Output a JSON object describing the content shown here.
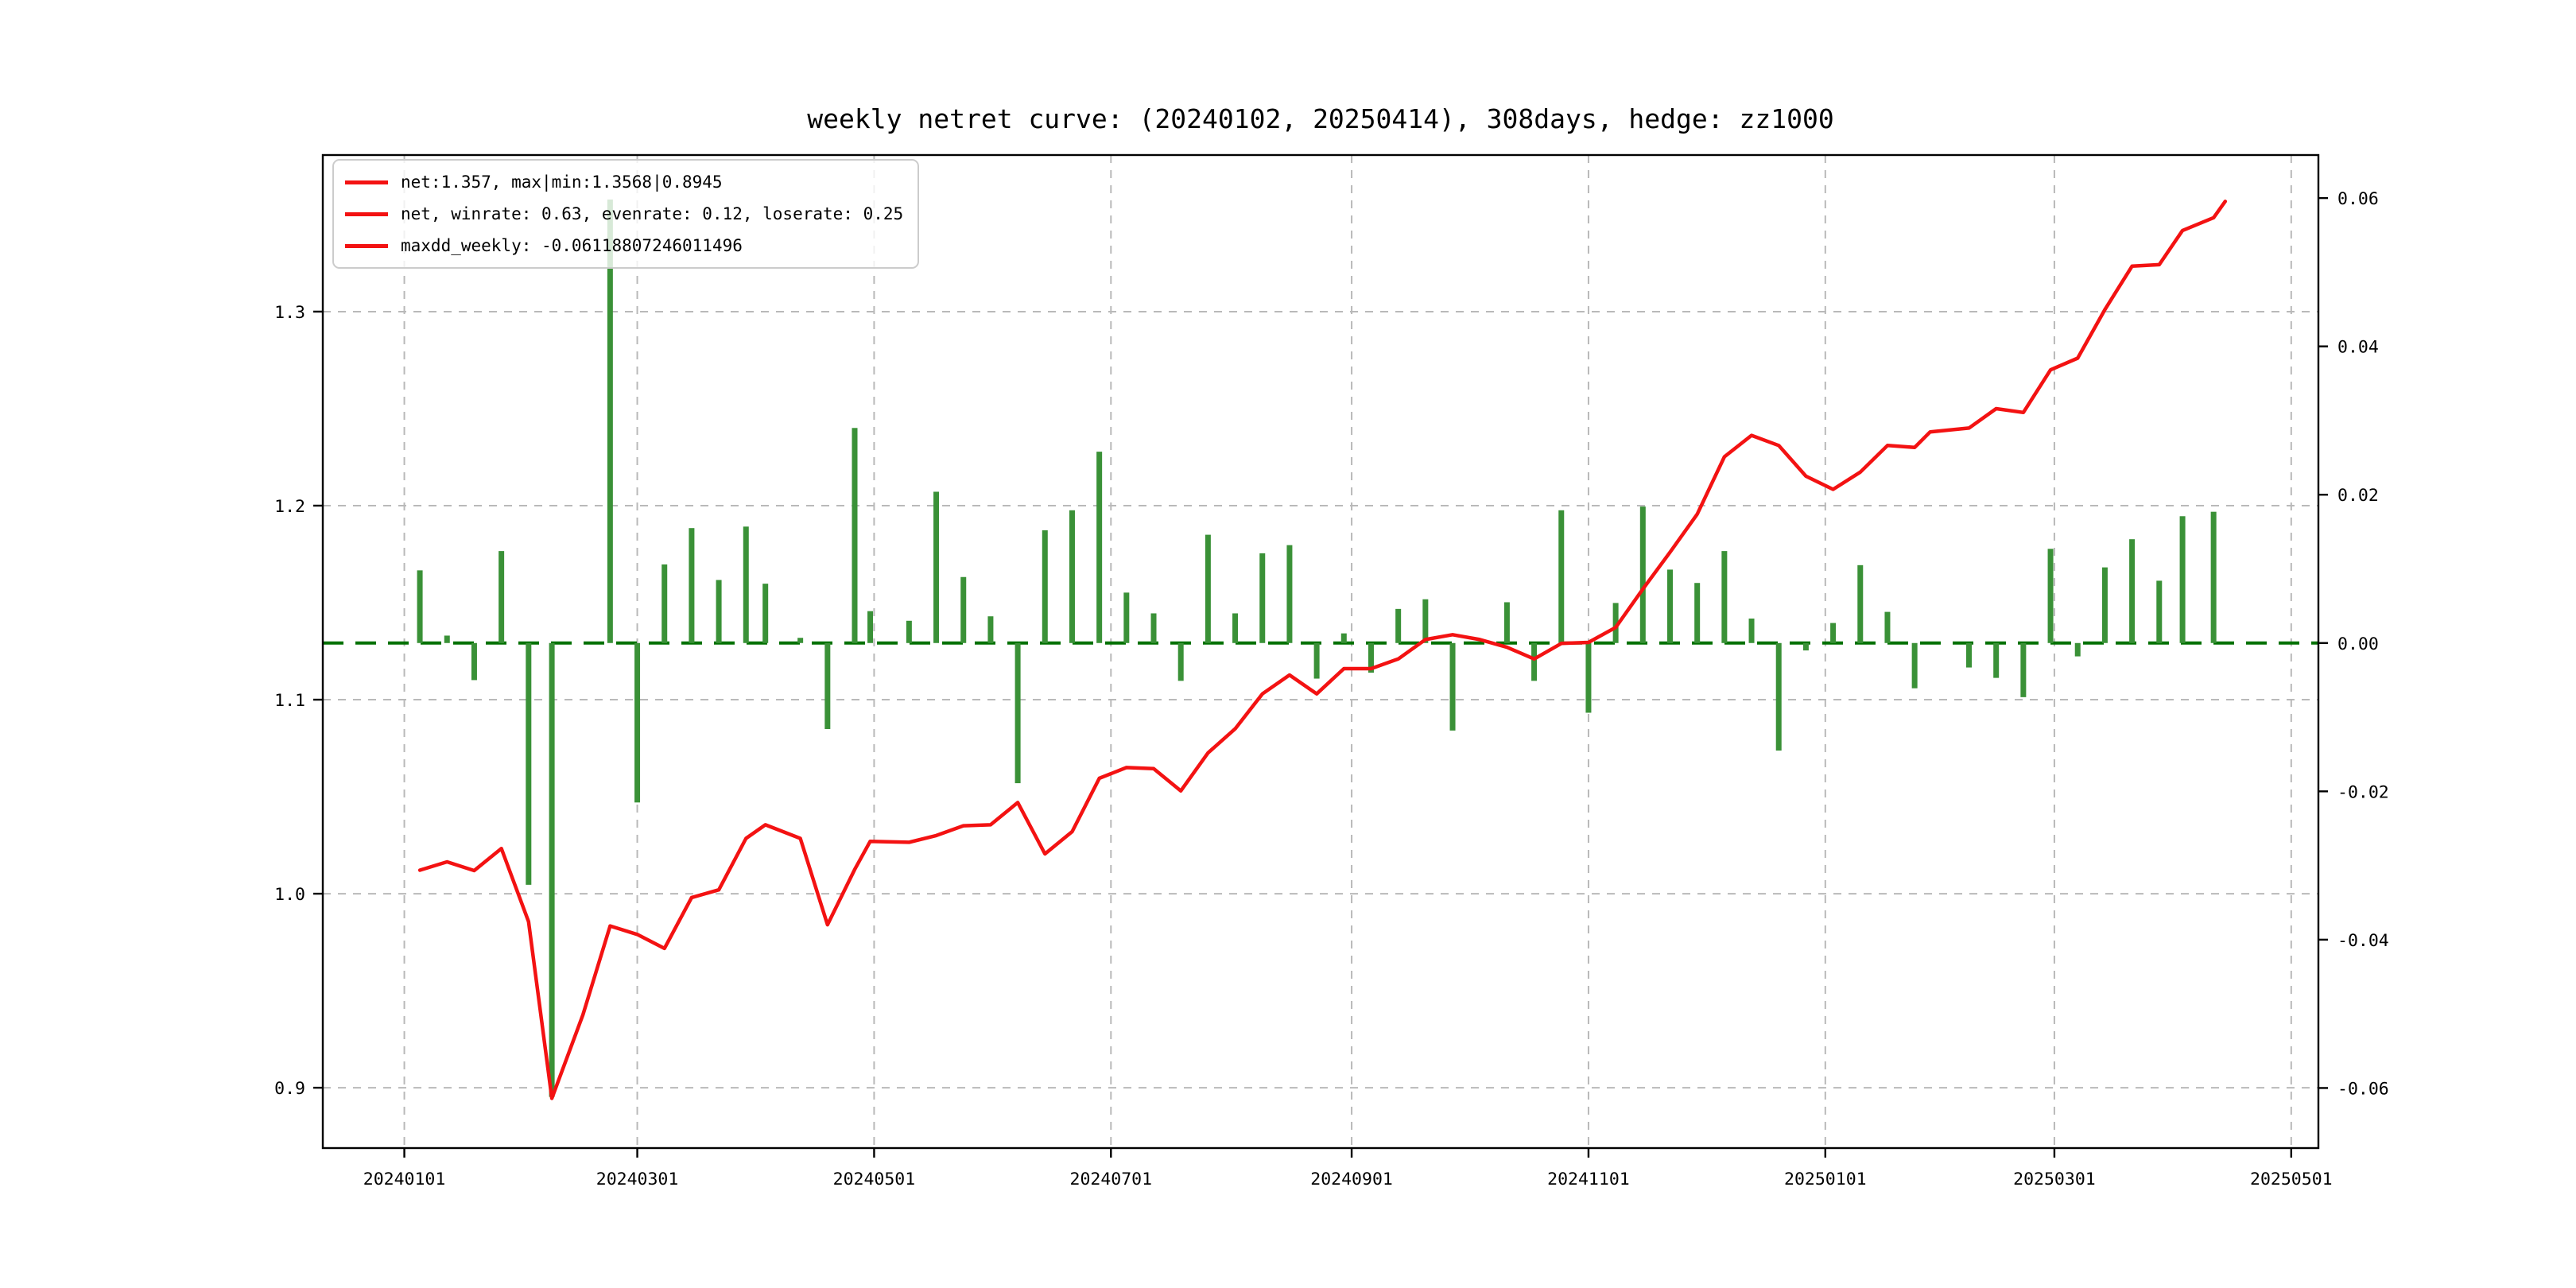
{
  "chart_data": {
    "type": "line+bar",
    "title": "weekly netret curve: (20240102, 20250414), 308days, hedge: zz1000",
    "legend": [
      "net:1.357, max|min:1.3568|0.8945",
      "net, winrate: 0.63, evenrate: 0.12, loserate: 0.25",
      "maxdd_weekly: -0.06118807246011496"
    ],
    "colors": {
      "net_line": "#f31212",
      "bar": "#3a9137",
      "zero_line": "#017101",
      "grid": "#b9b9b9",
      "spine": "#000000",
      "legend_border": "#cccccc"
    },
    "x_axis": {
      "lim": [
        "20231211",
        "20250508"
      ],
      "ticks": [
        "20240101",
        "20240301",
        "20240501",
        "20240701",
        "20240901",
        "20241101",
        "20250101",
        "20250301",
        "20250501"
      ]
    },
    "left_axis": {
      "lim": [
        0.8689,
        1.3807
      ],
      "tick_values": [
        1.3,
        1.2,
        1.1,
        1.0,
        0.9
      ],
      "tick_labels": [
        "1.3",
        "1.2",
        "1.1",
        "1.0",
        "0.9"
      ]
    },
    "right_axis": {
      "lim": [
        -0.0681,
        0.0658
      ],
      "tick_values": [
        0.06,
        0.04,
        0.02,
        0.0,
        -0.02,
        -0.04,
        -0.06
      ],
      "tick_labels": [
        "0.06",
        "0.04",
        "0.02",
        "0.00",
        "-0.02",
        "-0.04",
        "-0.06"
      ]
    },
    "zero_line_value": 0.0,
    "net_series": {
      "name": "net",
      "axis": "left",
      "points": [
        [
          "20240105",
          1.0121
        ],
        [
          "20240112",
          1.0164
        ],
        [
          "20240119",
          1.0119
        ],
        [
          "20240126",
          1.0233
        ],
        [
          "20240202",
          0.9856
        ],
        [
          "20240208",
          0.8945
        ],
        [
          "20240216",
          0.9376
        ],
        [
          "20240223",
          0.9834
        ],
        [
          "20240301",
          0.979
        ],
        [
          "20240308",
          0.9718
        ],
        [
          "20240315",
          0.998
        ],
        [
          "20240322",
          1.002
        ],
        [
          "20240329",
          1.0285
        ],
        [
          "20240403",
          1.0355
        ],
        [
          "20240412",
          1.0285
        ],
        [
          "20240419",
          0.984
        ],
        [
          "20240426",
          1.0125
        ],
        [
          "20240430",
          1.027
        ],
        [
          "20240510",
          1.0265
        ],
        [
          "20240517",
          1.03
        ],
        [
          "20240524",
          1.035
        ],
        [
          "20240531",
          1.0355
        ],
        [
          "20240607",
          1.047
        ],
        [
          "20240614",
          1.0205
        ],
        [
          "20240621",
          1.032
        ],
        [
          "20240628",
          1.0595
        ],
        [
          "20240705",
          1.065
        ],
        [
          "20240712",
          1.0645
        ],
        [
          "20240719",
          1.053
        ],
        [
          "20240726",
          1.0726
        ],
        [
          "20240802",
          1.085
        ],
        [
          "20240809",
          1.103
        ],
        [
          "20240816",
          1.1127
        ],
        [
          "20240823",
          1.103
        ],
        [
          "20240830",
          1.116
        ],
        [
          "20240906",
          1.116
        ],
        [
          "20240913",
          1.121
        ],
        [
          "20240920",
          1.131
        ],
        [
          "20240927",
          1.1335
        ],
        [
          "20241004",
          1.131
        ],
        [
          "20241011",
          1.127
        ],
        [
          "20241018",
          1.121
        ],
        [
          "20241025",
          1.129
        ],
        [
          "20241101",
          1.1295
        ],
        [
          "20241108",
          1.1372
        ],
        [
          "20241115",
          1.157
        ],
        [
          "20241122",
          1.176
        ],
        [
          "20241129",
          1.1956
        ],
        [
          "20241206",
          1.2252
        ],
        [
          "20241213",
          1.2362
        ],
        [
          "20241220",
          1.231
        ],
        [
          "20241227",
          1.2152
        ],
        [
          "20250103",
          1.2084
        ],
        [
          "20250110",
          1.2173
        ],
        [
          "20250117",
          1.231
        ],
        [
          "20250124",
          1.23
        ],
        [
          "20250128",
          1.238
        ],
        [
          "20250207",
          1.24
        ],
        [
          "20250214",
          1.25
        ],
        [
          "20250221",
          1.248
        ],
        [
          "20250228",
          1.27
        ],
        [
          "20250307",
          1.276
        ],
        [
          "20250314",
          1.301
        ],
        [
          "20250321",
          1.3234
        ],
        [
          "20250328",
          1.3242
        ],
        [
          "20250403",
          1.3418
        ],
        [
          "20250411",
          1.3484
        ],
        [
          "20250414",
          1.3568
        ]
      ]
    },
    "weekly_return_bars": {
      "name": "weekly netret",
      "axis": "right",
      "points": [
        [
          "20240105",
          0.0098
        ],
        [
          "20240112",
          0.001
        ],
        [
          "20240119",
          -0.005
        ],
        [
          "20240126",
          0.0124
        ],
        [
          "20240202",
          -0.0326
        ],
        [
          "20240208",
          -0.0612
        ],
        [
          "20240223",
          0.0598
        ],
        [
          "20240301",
          -0.0215
        ],
        [
          "20240308",
          0.0106
        ],
        [
          "20240315",
          0.0155
        ],
        [
          "20240322",
          0.0085
        ],
        [
          "20240329",
          0.0157
        ],
        [
          "20240403",
          0.008
        ],
        [
          "20240412",
          0.0007
        ],
        [
          "20240419",
          -0.0116
        ],
        [
          "20240426",
          0.029
        ],
        [
          "20240430",
          0.0043
        ],
        [
          "20240510",
          0.003
        ],
        [
          "20240517",
          0.0204
        ],
        [
          "20240524",
          0.0089
        ],
        [
          "20240531",
          0.0036
        ],
        [
          "20240607",
          -0.0189
        ],
        [
          "20240614",
          0.0152
        ],
        [
          "20240621",
          0.0179
        ],
        [
          "20240628",
          0.0258
        ],
        [
          "20240705",
          0.0068
        ],
        [
          "20240712",
          0.004
        ],
        [
          "20240719",
          -0.0051
        ],
        [
          "20240726",
          0.0146
        ],
        [
          "20240802",
          0.004
        ],
        [
          "20240809",
          0.0121
        ],
        [
          "20240816",
          0.0132
        ],
        [
          "20240823",
          -0.0048
        ],
        [
          "20240830",
          0.0013
        ],
        [
          "20240906",
          -0.004
        ],
        [
          "20240913",
          0.0046
        ],
        [
          "20240920",
          0.0059
        ],
        [
          "20240927",
          -0.0118
        ],
        [
          "20241011",
          0.0055
        ],
        [
          "20241018",
          -0.0051
        ],
        [
          "20241025",
          0.0179
        ],
        [
          "20241101",
          -0.0094
        ],
        [
          "20241108",
          0.0054
        ],
        [
          "20241115",
          0.0184
        ],
        [
          "20241122",
          0.0099
        ],
        [
          "20241129",
          0.0081
        ],
        [
          "20241206",
          0.0124
        ],
        [
          "20241213",
          0.0033
        ],
        [
          "20241220",
          -0.0145
        ],
        [
          "20241227",
          -0.001
        ],
        [
          "20250103",
          0.0027
        ],
        [
          "20250110",
          0.0105
        ],
        [
          "20250117",
          0.0042
        ],
        [
          "20250124",
          -0.0061
        ],
        [
          "20250207",
          -0.0033
        ],
        [
          "20250214",
          -0.0047
        ],
        [
          "20250221",
          -0.0073
        ],
        [
          "20250228",
          0.0127
        ],
        [
          "20250307",
          -0.0018
        ],
        [
          "20250314",
          0.0102
        ],
        [
          "20250321",
          0.014
        ],
        [
          "20250328",
          0.0084
        ],
        [
          "20250403",
          0.0171
        ],
        [
          "20250411",
          0.0177
        ]
      ]
    }
  }
}
